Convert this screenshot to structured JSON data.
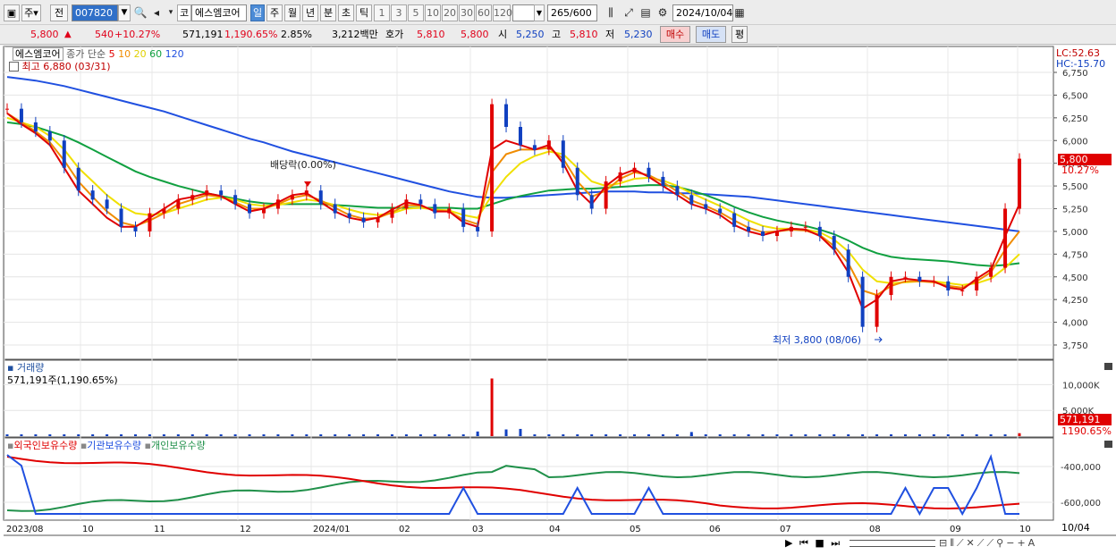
{
  "toolbar": {
    "market_label": "주",
    "prev_label": "전",
    "code": "007820",
    "stock_market_badge": "코",
    "stock_name": "에스엠코어",
    "periods": [
      "일",
      "주",
      "월",
      "년",
      "분",
      "초",
      "틱"
    ],
    "active_period": "일",
    "counts": [
      "1",
      "3",
      "5",
      "10",
      "20",
      "30",
      "60",
      "120"
    ],
    "range_value": "265",
    "range_total": "/600",
    "date": "2024/10/04"
  },
  "quote": {
    "price": "5,800",
    "change": "540",
    "change_pct": "+10.27%",
    "volume": "571,191",
    "volume_pct": "1,190.65%",
    "turnover": "2.85%",
    "amount": "3,212백만",
    "bid_label": "호가",
    "bid1": "5,810",
    "bid2": "5,800",
    "open_label": "시",
    "open": "5,250",
    "high_label": "고",
    "high": "5,810",
    "low_label": "저",
    "low": "5,230",
    "buy_label": "매수",
    "sell_label": "매도",
    "flat_label": "평"
  },
  "price_pane": {
    "name": "에스엠코어",
    "legend_title": "종가 단순",
    "ma_periods": [
      "5",
      "10",
      "20",
      "60",
      "120"
    ],
    "ma_colors": [
      "#e00000",
      "#f08c00",
      "#f0e000",
      "#10a040",
      "#2050e0"
    ],
    "high_note": "최고 6,880 (03/31)",
    "low_note": "최저 3,800 (08/06)",
    "dividend_note": "배당락(0.00%)",
    "lc": "LC:52.63",
    "hc": "HC:-15.70",
    "price_tag": "5,800",
    "pct_tag": "10.27%"
  },
  "volume_pane": {
    "title": "거래량",
    "value": "571,191주(1,190.65%)",
    "tag_value": "571,191",
    "tag_pct": "1190.65%"
  },
  "holdings_pane": {
    "series": [
      "외국인보유수량",
      "기관보유수량",
      "개인보유수량"
    ],
    "colors": [
      "#e00000",
      "#2050e0",
      "#20904a"
    ]
  },
  "x_axis": {
    "labels": [
      "2023/08",
      "10",
      "11",
      "12",
      "2024/01",
      "02",
      "03",
      "04",
      "05",
      "06",
      "07",
      "08",
      "09",
      "10"
    ],
    "right_label": "10/04"
  },
  "chart_data": {
    "type": "candlestick",
    "price_axis": {
      "ticks": [
        "6,750",
        "6,500",
        "6,250",
        "6,000",
        "5,750",
        "5,500",
        "5,250",
        "5,000",
        "4,750",
        "4,500",
        "4,250",
        "4,000",
        "3,750"
      ],
      "range": [
        3600,
        6950
      ]
    },
    "volume_axis": {
      "ticks": [
        "10,000K",
        "5,000K"
      ]
    },
    "holdings_axis": {
      "ticks": [
        "-400,000",
        "-600,000"
      ]
    },
    "price_close": [
      6350,
      6200,
      6100,
      6000,
      5700,
      5450,
      5350,
      5250,
      5050,
      5000,
      5200,
      5250,
      5350,
      5400,
      5450,
      5400,
      5300,
      5200,
      5250,
      5350,
      5400,
      5450,
      5300,
      5200,
      5150,
      5100,
      5150,
      5250,
      5350,
      5300,
      5200,
      5250,
      5050,
      5000,
      6400,
      6150,
      5950,
      5900,
      6000,
      5700,
      5400,
      5250,
      5550,
      5650,
      5700,
      5600,
      5500,
      5400,
      5300,
      5250,
      5200,
      5050,
      5000,
      4950,
      5000,
      5050,
      5050,
      4950,
      4800,
      4500,
      3950,
      4300,
      4500,
      4500,
      4450,
      4450,
      4350,
      4350,
      4500,
      4600,
      5250,
      5800
    ],
    "ma5": [
      6300,
      6180,
      6080,
      5950,
      5700,
      5450,
      5300,
      5150,
      5050,
      5050,
      5150,
      5250,
      5350,
      5380,
      5420,
      5390,
      5300,
      5220,
      5250,
      5320,
      5400,
      5420,
      5320,
      5220,
      5150,
      5120,
      5150,
      5240,
      5320,
      5290,
      5220,
      5220,
      5100,
      5050,
      5900,
      6000,
      5950,
      5900,
      5950,
      5750,
      5450,
      5300,
      5500,
      5620,
      5680,
      5600,
      5500,
      5400,
      5300,
      5250,
      5180,
      5070,
      5000,
      4960,
      5000,
      5030,
      5020,
      4950,
      4800,
      4550,
      4150,
      4250,
      4450,
      4480,
      4460,
      4450,
      4380,
      4360,
      4480,
      4580,
      4950,
      5300
    ],
    "ma10": [
      6300,
      6200,
      6100,
      5980,
      5780,
      5550,
      5380,
      5220,
      5100,
      5060,
      5120,
      5200,
      5300,
      5350,
      5400,
      5380,
      5320,
      5250,
      5250,
      5300,
      5370,
      5400,
      5340,
      5260,
      5180,
      5140,
      5150,
      5210,
      5290,
      5280,
      5230,
      5220,
      5130,
      5080,
      5650,
      5850,
      5900,
      5900,
      5920,
      5800,
      5550,
      5380,
      5450,
      5580,
      5650,
      5620,
      5540,
      5440,
      5340,
      5280,
      5210,
      5120,
      5040,
      4990,
      5000,
      5020,
      5010,
      4960,
      4840,
      4650,
      4350,
      4300,
      4400,
      4450,
      4450,
      4440,
      4400,
      4380,
      4450,
      4550,
      4800,
      5000
    ],
    "ma20": [
      6250,
      6200,
      6150,
      6050,
      5900,
      5700,
      5550,
      5400,
      5280,
      5200,
      5180,
      5200,
      5250,
      5300,
      5350,
      5370,
      5350,
      5300,
      5280,
      5290,
      5320,
      5350,
      5330,
      5290,
      5240,
      5200,
      5180,
      5200,
      5250,
      5260,
      5240,
      5230,
      5180,
      5150,
      5400,
      5600,
      5750,
      5830,
      5880,
      5850,
      5700,
      5550,
      5500,
      5530,
      5580,
      5590,
      5560,
      5500,
      5420,
      5350,
      5280,
      5200,
      5120,
      5060,
      5030,
      5030,
      5020,
      4990,
      4910,
      4780,
      4580,
      4450,
      4430,
      4440,
      4450,
      4450,
      4430,
      4410,
      4430,
      4480,
      4600,
      4750
    ],
    "ma60": [
      6200,
      6180,
      6150,
      6100,
      6050,
      5980,
      5900,
      5820,
      5740,
      5660,
      5600,
      5550,
      5500,
      5460,
      5420,
      5390,
      5360,
      5330,
      5310,
      5300,
      5300,
      5300,
      5300,
      5290,
      5280,
      5270,
      5260,
      5260,
      5260,
      5260,
      5260,
      5260,
      5250,
      5250,
      5300,
      5350,
      5390,
      5420,
      5450,
      5460,
      5470,
      5470,
      5480,
      5490,
      5500,
      5510,
      5510,
      5490,
      5450,
      5400,
      5340,
      5270,
      5210,
      5160,
      5120,
      5090,
      5060,
      5020,
      4970,
      4900,
      4820,
      4760,
      4720,
      4700,
      4690,
      4680,
      4670,
      4650,
      4630,
      4620,
      4630,
      4650
    ],
    "ma120": [
      6700,
      6680,
      6660,
      6630,
      6600,
      6560,
      6520,
      6480,
      6440,
      6400,
      6360,
      6320,
      6270,
      6220,
      6170,
      6120,
      6070,
      6020,
      5980,
      5930,
      5880,
      5840,
      5800,
      5760,
      5720,
      5680,
      5640,
      5600,
      5560,
      5520,
      5480,
      5440,
      5410,
      5380,
      5370,
      5370,
      5380,
      5390,
      5400,
      5410,
      5420,
      5430,
      5440,
      5440,
      5440,
      5430,
      5430,
      5420,
      5420,
      5410,
      5400,
      5390,
      5380,
      5360,
      5340,
      5320,
      5300,
      5280,
      5260,
      5240,
      5220,
      5200,
      5180,
      5160,
      5140,
      5120,
      5100,
      5080,
      5060,
      5040,
      5020,
      5000
    ],
    "volume_spikes": [
      {
        "i": 34,
        "v": 11200
      },
      {
        "i": 35,
        "v": 1300
      },
      {
        "i": 36,
        "v": 1400
      },
      {
        "i": 33,
        "v": 900
      },
      {
        "i": 48,
        "v": 800
      },
      {
        "i": 71,
        "v": 571
      }
    ]
  }
}
